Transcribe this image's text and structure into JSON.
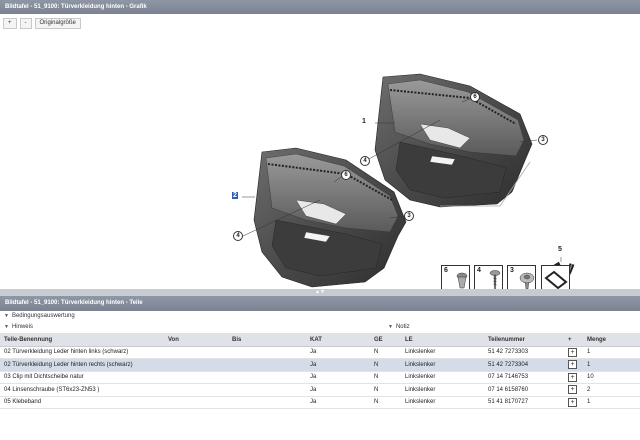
{
  "graphic_panel": {
    "title": "Bildtafel - 51_9100: Türverkleidung hinten - Grafik",
    "zoom_in_label": "+",
    "zoom_out_label": "-",
    "original_size_label": "Originalgröße"
  },
  "callouts": {
    "c1": "1",
    "c2": "2",
    "c3a": "3",
    "c3b": "3",
    "c4a": "4",
    "c4b": "4",
    "c5": "5",
    "c6a": "6",
    "c6b": "6"
  },
  "thumbnails": [
    {
      "number": "6",
      "icon": "clip-icon"
    },
    {
      "number": "4",
      "icon": "screw-icon"
    },
    {
      "number": "3",
      "icon": "sealing-clip-icon"
    },
    {
      "number": "",
      "icon": "adhesive-tape-icon"
    }
  ],
  "splitter_grip": "▲▼",
  "parts_panel": {
    "title": "Bildtafel - 51_9100: Türverkleidung hinten - Teile",
    "condition_label": "Bedingungsauswertung",
    "hint_label": "Hinweis",
    "note_label": "Notiz"
  },
  "table": {
    "headers": [
      "Teile-Benennung",
      "Von",
      "Bis",
      "KAT",
      "GE",
      "LE",
      "Teilenummer",
      "+",
      "Menge"
    ],
    "rows": [
      {
        "name": "02 Türverkleidung Leder hinten links (schwarz)",
        "von": "",
        "bis": "",
        "kat": "Ja",
        "ge": "N",
        "le": "Linkslenker",
        "teilenummer": "51 42 7273303",
        "menge": "1",
        "selected": false
      },
      {
        "name": "02 Türverkleidung Leder hinten rechts (schwarz)",
        "von": "",
        "bis": "",
        "kat": "Ja",
        "ge": "N",
        "le": "Linkslenker",
        "teilenummer": "51 42 7273304",
        "menge": "1",
        "selected": true
      },
      {
        "name": "03 Clip mit Dichtscheibe natur",
        "von": "",
        "bis": "",
        "kat": "Ja",
        "ge": "N",
        "le": "Linkslenker",
        "teilenummer": "07 14 7146753",
        "menge": "10",
        "selected": false
      },
      {
        "name": "04 Linsenschraube (ST6x23-ZN53 )",
        "von": "",
        "bis": "",
        "kat": "Ja",
        "ge": "N",
        "le": "Linkslenker",
        "teilenummer": "07 14 6158760",
        "menge": "2",
        "selected": false
      },
      {
        "name": "05 Klebeband",
        "von": "",
        "bis": "",
        "kat": "Ja",
        "ge": "N",
        "le": "Linkslenker",
        "teilenummer": "51 41 8170727",
        "menge": "1",
        "selected": false
      }
    ],
    "add_symbol": "+"
  }
}
